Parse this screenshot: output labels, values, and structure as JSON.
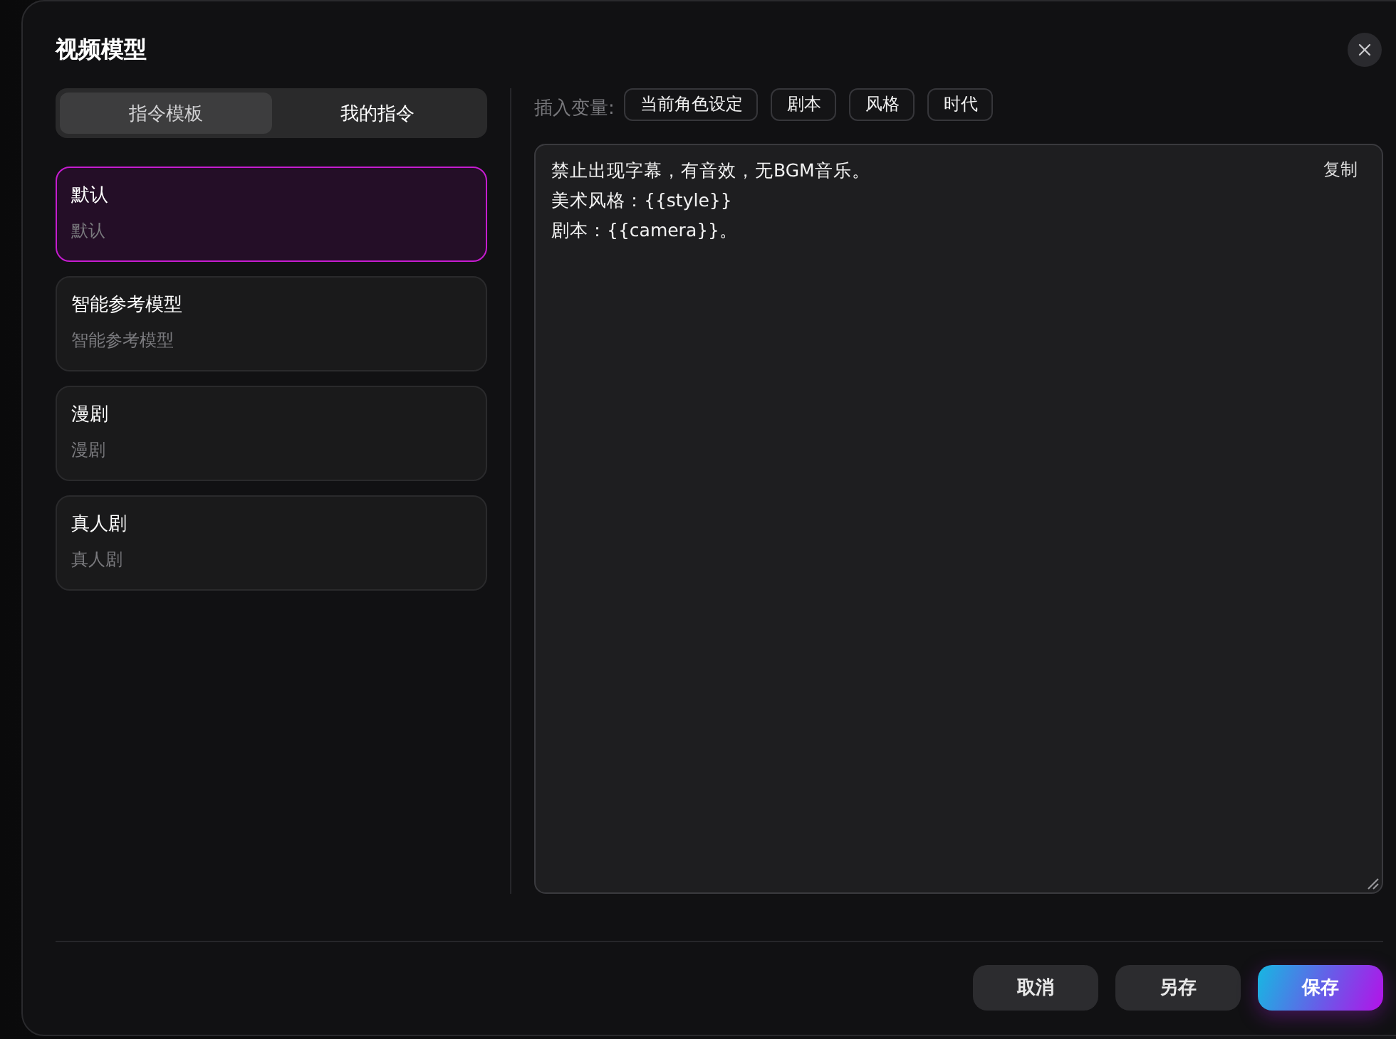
{
  "dialog_title": "视频模型",
  "tabs": [
    {
      "label": "指令模板",
      "selected": true
    },
    {
      "label": "我的指令",
      "selected": false
    }
  ],
  "templates": [
    {
      "title": "默认",
      "subtitle": "默认",
      "selected": true
    },
    {
      "title": "智能参考模型",
      "subtitle": "智能参考模型",
      "selected": false
    },
    {
      "title": "漫剧",
      "subtitle": "漫剧",
      "selected": false
    },
    {
      "title": "真人剧",
      "subtitle": "真人剧",
      "selected": false
    }
  ],
  "insert_variables": {
    "label": "插入变量:",
    "chips": [
      "当前角色设定",
      "剧本",
      "风格",
      "时代"
    ]
  },
  "editor": {
    "lines": [
      "禁止出现字幕，有音效，无BGM音乐。",
      "美术风格：{{style}}",
      "剧本：{{camera}}。"
    ],
    "copy_button": "复制"
  },
  "buttons": [
    {
      "label": "取消",
      "kind": "secondary"
    },
    {
      "label": "另存",
      "kind": "secondary"
    },
    {
      "label": "保存",
      "kind": "primary"
    }
  ]
}
